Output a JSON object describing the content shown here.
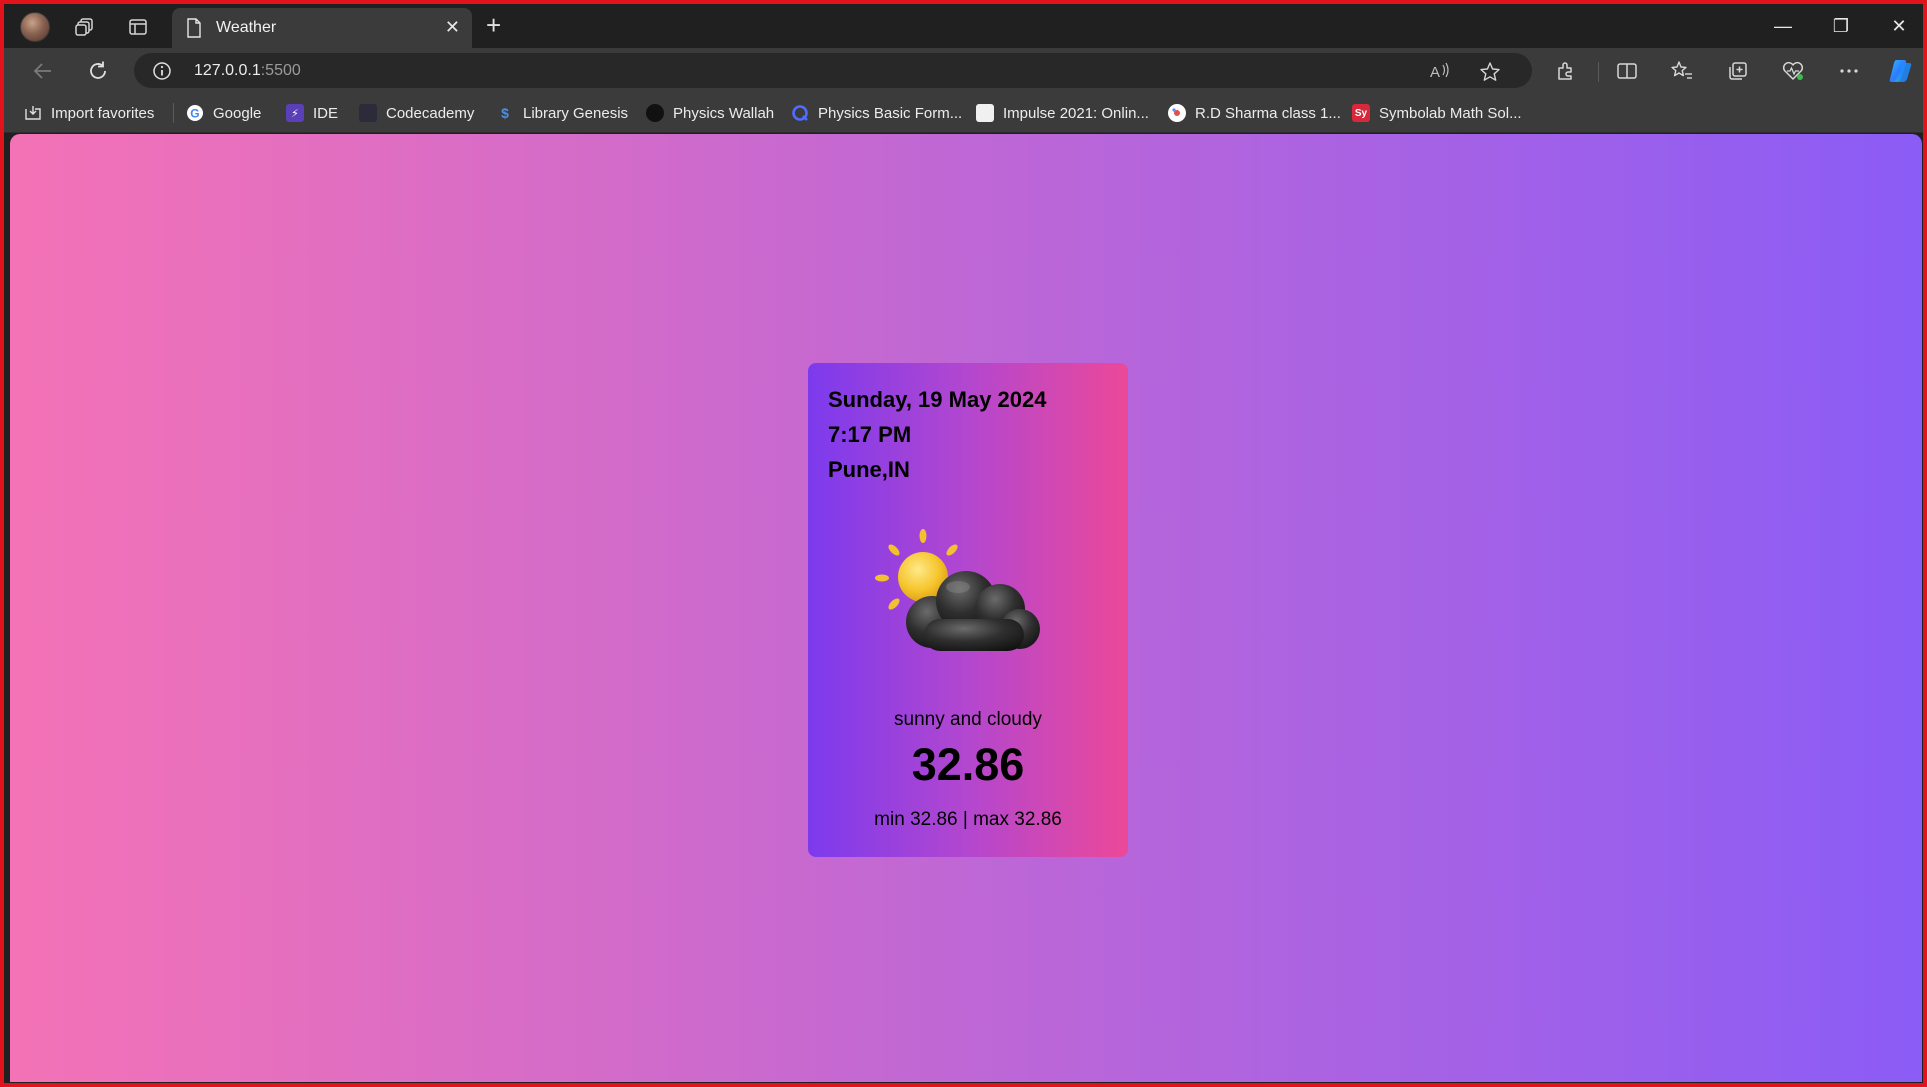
{
  "browser": {
    "tab": {
      "title": "Weather",
      "close_glyph": "✕"
    },
    "new_tab_glyph": "+",
    "address": {
      "host": "127.0.0.1",
      "port": ":5500"
    },
    "window_controls": {
      "minimize": "—",
      "restore": "❐",
      "close": "✕"
    },
    "bookmarks": [
      {
        "label": "Import favorites",
        "icon": "import-icon"
      },
      {
        "label": "Google",
        "icon": "google-icon"
      },
      {
        "label": "IDE",
        "icon": "ide-icon"
      },
      {
        "label": "Codecademy",
        "icon": "codecademy-icon"
      },
      {
        "label": "Library Genesis",
        "icon": "library-genesis-icon"
      },
      {
        "label": "Physics Wallah",
        "icon": "physics-wallah-icon"
      },
      {
        "label": "Physics Basic Form...",
        "icon": "quora-icon"
      },
      {
        "label": "Impulse 2021: Onlin...",
        "icon": "impulse-icon"
      },
      {
        "label": "R.D Sharma class 1...",
        "icon": "rd-sharma-icon"
      },
      {
        "label": "Symbolab Math Sol...",
        "icon": "symbolab-icon"
      }
    ]
  },
  "weather": {
    "date": "Sunday, 19 May 2024",
    "time": "7:17 PM",
    "location": "Pune,IN",
    "icon": "sun-behind-cloud-icon",
    "condition": "sunny and cloudy",
    "temperature": "32.86",
    "range": "min 32.86 | max 32.86"
  },
  "colors": {
    "page_gradient_start": "#f472b6",
    "page_gradient_end": "#8b5cf6",
    "card_gradient_start": "#7c3aed",
    "card_gradient_end": "#ec4899",
    "window_border": "#e0141a"
  }
}
